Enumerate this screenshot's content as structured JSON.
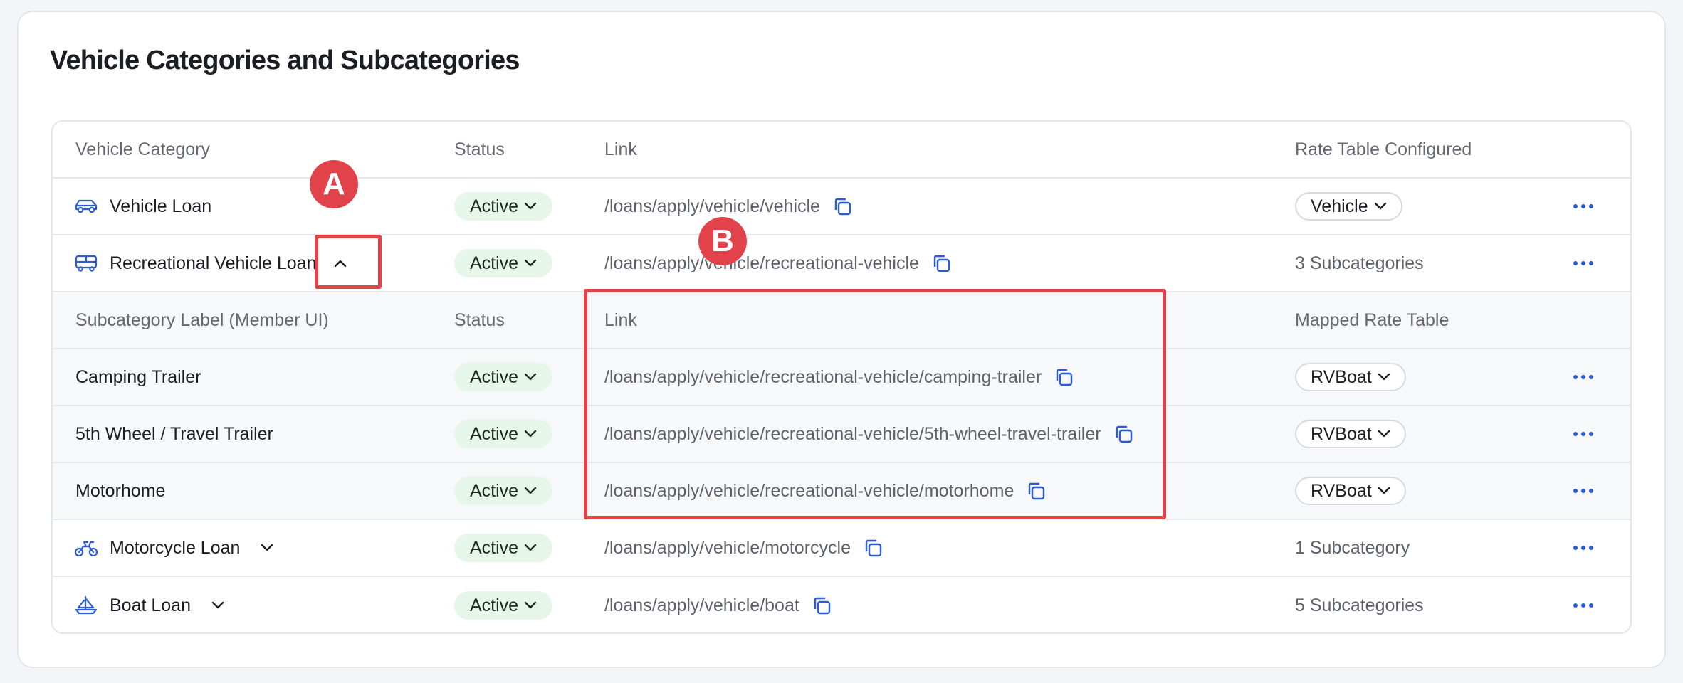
{
  "page": {
    "title": "Vehicle Categories and Subcategories"
  },
  "table": {
    "headers": {
      "category": "Vehicle Category",
      "status": "Status",
      "link": "Link",
      "rate": "Rate Table Configured"
    },
    "rows": [
      {
        "name": "Vehicle Loan",
        "icon": "car-icon",
        "status": "Active",
        "link": "/loans/apply/vehicle/vehicle",
        "rate_pill": "Vehicle"
      },
      {
        "name": "Recreational Vehicle Loan",
        "icon": "rv-icon",
        "status": "Active",
        "link": "/loans/apply/vehicle/recreational-vehicle",
        "rate_text": "3 Subcategories",
        "expanded": true
      }
    ],
    "sub_headers": {
      "label": "Subcategory Label (Member UI)",
      "status": "Status",
      "link": "Link",
      "rate": "Mapped Rate Table"
    },
    "sub_rows": [
      {
        "name": "Camping Trailer",
        "status": "Active",
        "link": "/loans/apply/vehicle/recreational-vehicle/camping-trailer",
        "rate_pill": "RVBoat"
      },
      {
        "name": "5th Wheel / Travel Trailer",
        "status": "Active",
        "link": "/loans/apply/vehicle/recreational-vehicle/5th-wheel-travel-trailer",
        "rate_pill": "RVBoat"
      },
      {
        "name": "Motorhome",
        "status": "Active",
        "link": "/loans/apply/vehicle/recreational-vehicle/motorhome",
        "rate_pill": "RVBoat"
      }
    ],
    "rows_after": [
      {
        "name": "Motorcycle Loan",
        "icon": "motorcycle-icon",
        "status": "Active",
        "link": "/loans/apply/vehicle/motorcycle",
        "rate_text": "1 Subcategory"
      },
      {
        "name": "Boat Loan",
        "icon": "boat-icon",
        "status": "Active",
        "link": "/loans/apply/vehicle/boat",
        "rate_text": "5 Subcategories"
      }
    ]
  },
  "annotations": {
    "a": "A",
    "b": "B"
  },
  "colors": {
    "accent": "#2c5bd6",
    "status_bg": "#e6f6ea",
    "annotation": "#e2434a"
  }
}
